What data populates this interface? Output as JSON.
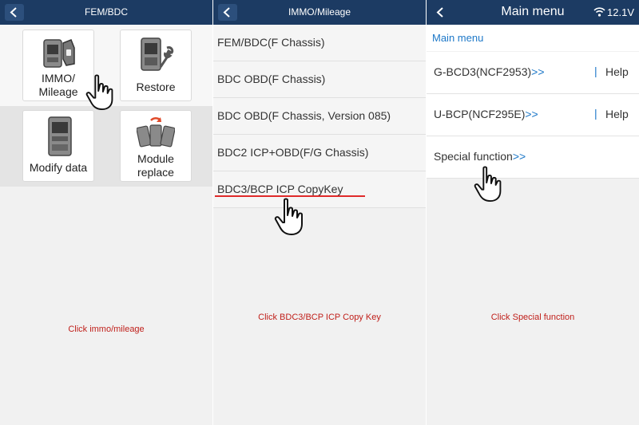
{
  "panel1": {
    "title": "FEM/BDC",
    "tiles": [
      {
        "label": "IMMO/\nMileage",
        "icon": "ecu-with-key-icon"
      },
      {
        "label": "Restore",
        "icon": "ecu-with-wrench-icon"
      },
      {
        "label": "Modify data",
        "icon": "ecu-module-icon"
      },
      {
        "label": "Module\nreplace",
        "icon": "modules-swap-icon"
      }
    ],
    "caption": "Click immo/mileage"
  },
  "panel2": {
    "title": "IMMO/Mileage",
    "items": [
      "FEM/BDC(F Chassis)",
      "BDC OBD(F Chassis)",
      "BDC OBD(F Chassis, Version 085)",
      "BDC2 ICP+OBD(F/G Chassis)",
      "BDC3/BCP ICP CopyKey"
    ],
    "caption": "Click BDC3/BCP ICP Copy Key"
  },
  "panel3": {
    "title": "Main menu",
    "voltage": "12.1V",
    "header": "Main menu",
    "rows": [
      {
        "name": "G-BCD3(NCF2953)",
        "arrows": ">>",
        "sep": "|",
        "help": "Help"
      },
      {
        "name": "U-BCP(NCF295E)",
        "arrows": ">>",
        "sep": "|",
        "help": "Help"
      },
      {
        "name": "Special function",
        "arrows": ">>"
      }
    ],
    "caption": "Click Special function"
  },
  "colors": {
    "titlebar": "#1c3b63",
    "accent": "#1d78c8",
    "caption": "#c0201b",
    "underline": "#e02a2a"
  }
}
